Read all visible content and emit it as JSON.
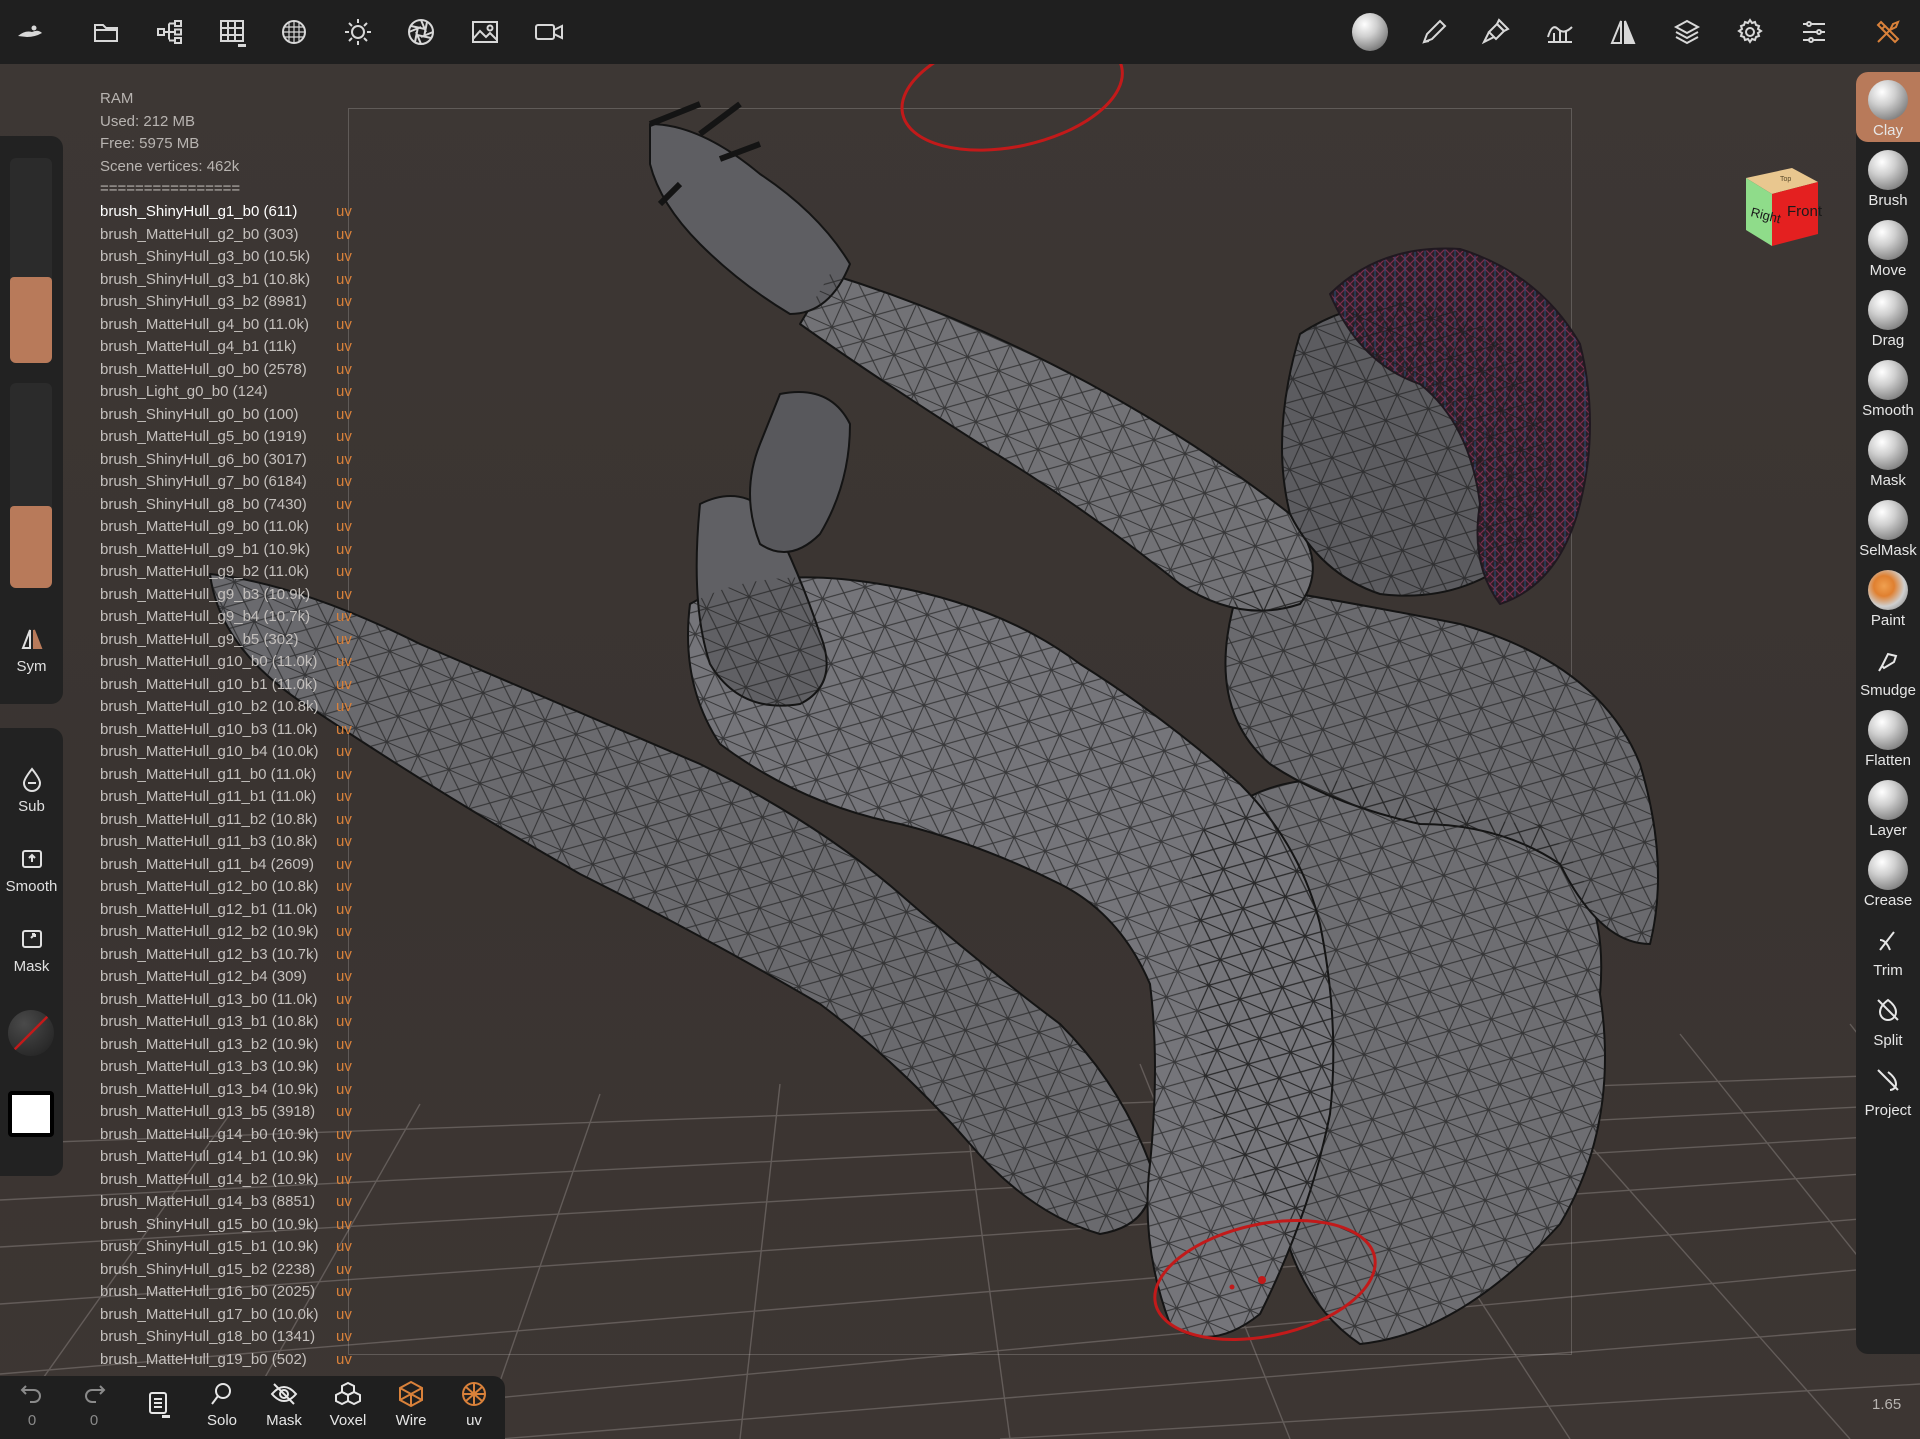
{
  "topbar": {
    "left_icons": [
      "nomad-logo-icon",
      "folder-icon",
      "scene-tree-icon",
      "grid-icon",
      "material-sphere-icon",
      "sun-icon",
      "aperture-icon",
      "image-icon",
      "video-camera-icon"
    ],
    "right_icons": [
      "matcap-sphere-icon",
      "pen-icon",
      "brush-tool-icon",
      "wave-icon",
      "symmetry-icon",
      "layers-icon",
      "gear-icon",
      "sliders-icon",
      "tools-icon"
    ]
  },
  "stats": {
    "ram_label": "RAM",
    "used": "Used: 212 MB",
    "free": "Free: 5975 MB",
    "vertices": "Scene vertices: 462k",
    "separator": "================"
  },
  "meshes": [
    {
      "name": "brush_ShinyHull_g1_b0 (611)",
      "uv": "uv",
      "active": true
    },
    {
      "name": "brush_MatteHull_g2_b0 (303)",
      "uv": "uv"
    },
    {
      "name": "brush_ShinyHull_g3_b0 (10.5k)",
      "uv": "uv"
    },
    {
      "name": "brush_ShinyHull_g3_b1 (10.8k)",
      "uv": "uv"
    },
    {
      "name": "brush_ShinyHull_g3_b2 (8981)",
      "uv": "uv"
    },
    {
      "name": "brush_MatteHull_g4_b0 (11.0k)",
      "uv": "uv"
    },
    {
      "name": "brush_MatteHull_g4_b1 (11k)",
      "uv": "uv"
    },
    {
      "name": "brush_MatteHull_g0_b0 (2578)",
      "uv": "uv"
    },
    {
      "name": "brush_Light_g0_b0 (124)",
      "uv": "uv"
    },
    {
      "name": "brush_ShinyHull_g0_b0 (100)",
      "uv": "uv"
    },
    {
      "name": "brush_MatteHull_g5_b0 (1919)",
      "uv": "uv"
    },
    {
      "name": "brush_ShinyHull_g6_b0 (3017)",
      "uv": "uv"
    },
    {
      "name": "brush_ShinyHull_g7_b0 (6184)",
      "uv": "uv"
    },
    {
      "name": "brush_ShinyHull_g8_b0 (7430)",
      "uv": "uv"
    },
    {
      "name": "brush_MatteHull_g9_b0 (11.0k)",
      "uv": "uv"
    },
    {
      "name": "brush_MatteHull_g9_b1 (10.9k)",
      "uv": "uv"
    },
    {
      "name": "brush_MatteHull_g9_b2 (11.0k)",
      "uv": "uv"
    },
    {
      "name": "brush_MatteHull_g9_b3 (10.9k)",
      "uv": "uv"
    },
    {
      "name": "brush_MatteHull_g9_b4 (10.7k)",
      "uv": "uv"
    },
    {
      "name": "brush_MatteHull_g9_b5 (302)",
      "uv": "uv"
    },
    {
      "name": "brush_MatteHull_g10_b0 (11.0k)",
      "uv": "uv"
    },
    {
      "name": "brush_MatteHull_g10_b1 (11.0k)",
      "uv": "uv"
    },
    {
      "name": "brush_MatteHull_g10_b2 (10.8k)",
      "uv": "uv"
    },
    {
      "name": "brush_MatteHull_g10_b3 (11.0k)",
      "uv": "uv"
    },
    {
      "name": "brush_MatteHull_g10_b4 (10.0k)",
      "uv": "uv"
    },
    {
      "name": "brush_MatteHull_g11_b0 (11.0k)",
      "uv": "uv"
    },
    {
      "name": "brush_MatteHull_g11_b1 (11.0k)",
      "uv": "uv"
    },
    {
      "name": "brush_MatteHull_g11_b2 (10.8k)",
      "uv": "uv"
    },
    {
      "name": "brush_MatteHull_g11_b3 (10.8k)",
      "uv": "uv"
    },
    {
      "name": "brush_MatteHull_g11_b4 (2609)",
      "uv": "uv"
    },
    {
      "name": "brush_MatteHull_g12_b0 (10.8k)",
      "uv": "uv"
    },
    {
      "name": "brush_MatteHull_g12_b1 (11.0k)",
      "uv": "uv"
    },
    {
      "name": "brush_MatteHull_g12_b2 (10.9k)",
      "uv": "uv"
    },
    {
      "name": "brush_MatteHull_g12_b3 (10.7k)",
      "uv": "uv"
    },
    {
      "name": "brush_MatteHull_g12_b4 (309)",
      "uv": "uv"
    },
    {
      "name": "brush_MatteHull_g13_b0 (11.0k)",
      "uv": "uv"
    },
    {
      "name": "brush_MatteHull_g13_b1 (10.8k)",
      "uv": "uv"
    },
    {
      "name": "brush_MatteHull_g13_b2 (10.9k)",
      "uv": "uv"
    },
    {
      "name": "brush_MatteHull_g13_b3 (10.9k)",
      "uv": "uv"
    },
    {
      "name": "brush_MatteHull_g13_b4 (10.9k)",
      "uv": "uv"
    },
    {
      "name": "brush_MatteHull_g13_b5 (3918)",
      "uv": "uv"
    },
    {
      "name": "brush_MatteHull_g14_b0 (10.9k)",
      "uv": "uv"
    },
    {
      "name": "brush_MatteHull_g14_b1 (10.9k)",
      "uv": "uv"
    },
    {
      "name": "brush_MatteHull_g14_b2 (10.9k)",
      "uv": "uv"
    },
    {
      "name": "brush_MatteHull_g14_b3 (8851)",
      "uv": "uv"
    },
    {
      "name": "brush_ShinyHull_g15_b0 (10.9k)",
      "uv": "uv"
    },
    {
      "name": "brush_ShinyHull_g15_b1 (10.9k)",
      "uv": "uv"
    },
    {
      "name": "brush_ShinyHull_g15_b2 (2238)",
      "uv": "uv"
    },
    {
      "name": "brush_MatteHull_g16_b0 (2025)",
      "uv": "uv"
    },
    {
      "name": "brush_MatteHull_g17_b0 (10.0k)",
      "uv": "uv"
    },
    {
      "name": "brush_ShinyHull_g18_b0 (1341)",
      "uv": "uv"
    },
    {
      "name": "brush_MatteHull_g19_b0 (502)",
      "uv": "uv"
    }
  ],
  "left_panel": {
    "radius_fill": 0.42,
    "intensity_fill": 0.4,
    "sym_label": "Sym",
    "sub_label": "Sub",
    "smooth_label": "Smooth",
    "mask_label": "Mask"
  },
  "tools": [
    {
      "label": "Clay",
      "active": true,
      "kind": "ball"
    },
    {
      "label": "Brush",
      "kind": "ball"
    },
    {
      "label": "Move",
      "kind": "ball"
    },
    {
      "label": "Drag",
      "kind": "ball"
    },
    {
      "label": "Smooth",
      "kind": "ball"
    },
    {
      "label": "Mask",
      "kind": "ball"
    },
    {
      "label": "SelMask",
      "kind": "ball"
    },
    {
      "label": "Paint",
      "kind": "paint"
    },
    {
      "label": "Smudge",
      "kind": "icon"
    },
    {
      "label": "Flatten",
      "kind": "ball"
    },
    {
      "label": "Layer",
      "kind": "ball"
    },
    {
      "label": "Crease",
      "kind": "ball"
    },
    {
      "label": "Trim",
      "kind": "icon"
    },
    {
      "label": "Split",
      "kind": "icon"
    },
    {
      "label": "Project",
      "kind": "icon"
    }
  ],
  "bottom": {
    "undo_count": "0",
    "redo_count": "0",
    "solo": "Solo",
    "mask": "Mask",
    "voxel": "Voxel",
    "wire": "Wire",
    "uv": "uv"
  },
  "navcube": {
    "front": "Front",
    "right": "Right",
    "top": "Top"
  },
  "zoom": "1.65",
  "colors": {
    "accent": "#b87a5a",
    "uv_text": "#d9813a",
    "selection_ring": "#c21a1a"
  }
}
